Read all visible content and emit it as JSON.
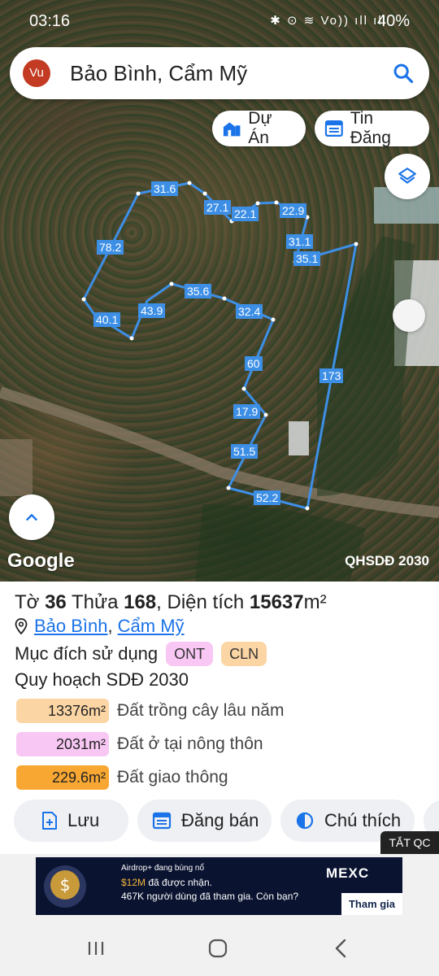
{
  "status_bar": {
    "time": "03:16",
    "icons": "✱ ⊙ ≋ Vo)) ıll ıll",
    "battery": "40%"
  },
  "search": {
    "avatar_text": "Vu",
    "query": "Bảo Bình, Cẩm Mỹ",
    "icon": "search-icon"
  },
  "chips": {
    "du_an": "Dự Án",
    "tin_dang": "Tin Đăng"
  },
  "map": {
    "logo": "Google",
    "overlay_label": "QHSDĐ 2030",
    "segment_labels": [
      "31.6",
      "27.1",
      "22.1",
      "22.9",
      "31.1",
      "35.1",
      "78.2",
      "35.6",
      "32.4",
      "40.1",
      "43.9",
      "60",
      "173",
      "17.9",
      "51.5",
      "52.2"
    ],
    "line_color": "#3d8fe6"
  },
  "parcel": {
    "prefix_to": "Tờ",
    "to": "36",
    "prefix_thua": "Thửa",
    "thua": "168",
    "prefix_area": ", Diện tích",
    "area": "15637",
    "unit": "m²",
    "location_commune": "Bảo Bình",
    "location_sep": ",",
    "location_district": "Cẩm Mỹ"
  },
  "purpose": {
    "label": "Mục đích sử dụng",
    "tags": [
      "ONT",
      "CLN"
    ]
  },
  "plan": {
    "title": "Quy hoạch SDĐ 2030",
    "rows": [
      {
        "area": "13376m²",
        "name": "Đất trồng cây lâu năm",
        "color": "#fcd5a4"
      },
      {
        "area": "2031m²",
        "name": "Đất ở tại nông thôn",
        "color": "#f8c7f4"
      },
      {
        "area": "229.6m²",
        "name": "Đất giao thông",
        "color": "#f8a733"
      }
    ]
  },
  "actions": {
    "save": "Lưu",
    "sell": "Đăng bán",
    "legend": "Chú thích"
  },
  "ad": {
    "close_label": "TẮT QC",
    "line1": "Airdrop+ đang bùng nổ",
    "line2_amount": "$12M",
    "line2_rest": " đã được nhận.",
    "line3": "467K người dùng đã tham gia. Còn bạn?",
    "brand": "MEXC",
    "cta": "Tham gia ngay"
  }
}
